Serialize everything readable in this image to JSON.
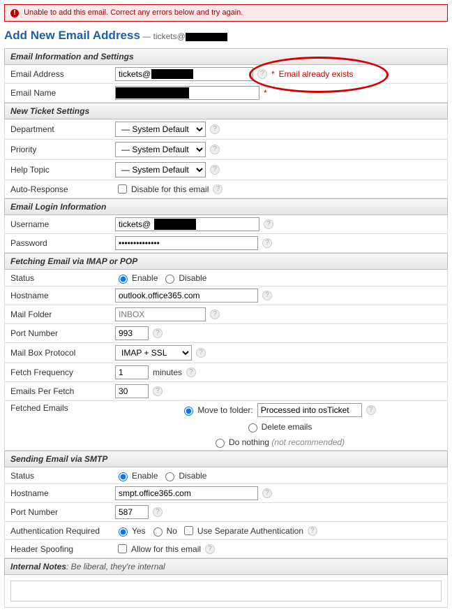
{
  "error_banner": "Unable to add this email. Correct any errors below and try again.",
  "page_title": "Add New Email Address",
  "page_title_sub_prefix": "— tickets@",
  "sections": {
    "info": "Email Information and Settings",
    "ticket": "New Ticket Settings",
    "login": "Email Login Information",
    "fetch": "Fetching Email via IMAP or POP",
    "send": "Sending Email via SMTP",
    "notes": "Internal Notes",
    "notes_hint": ": Be liberal, they're internal"
  },
  "labels": {
    "email_address": "Email Address",
    "email_name": "Email Name",
    "department": "Department",
    "priority": "Priority",
    "help_topic": "Help Topic",
    "auto_response": "Auto-Response",
    "username": "Username",
    "password": "Password",
    "status": "Status",
    "hostname": "Hostname",
    "mail_folder": "Mail Folder",
    "port_number": "Port Number",
    "mailbox_protocol": "Mail Box Protocol",
    "fetch_frequency": "Fetch Frequency",
    "emails_per_fetch": "Emails Per Fetch",
    "fetched_emails": "Fetched Emails",
    "auth_required": "Authentication Required",
    "header_spoofing": "Header Spoofing"
  },
  "values": {
    "email_address_prefix": "tickets@",
    "email_error": "Email already exists",
    "system_default": "— System Default —",
    "disable_for_email": "Disable for this email",
    "username_prefix": "tickets@",
    "password_mask": "••••••••••••••",
    "enable": "Enable",
    "disable": "Disable",
    "fetch_hostname": "outlook.office365.com",
    "mail_folder_ph": "INBOX",
    "fetch_port": "993",
    "protocol": "IMAP + SSL",
    "fetch_freq": "1",
    "minutes": "minutes",
    "per_fetch": "30",
    "move_to_folder": "Move to folder:",
    "processed_into": "Processed into osTicket",
    "delete_emails": "Delete emails",
    "do_nothing": "Do nothing",
    "not_recommended": "(not recommended)",
    "smtp_hostname": "smpt.office365.com",
    "smtp_port": "587",
    "yes": "Yes",
    "no": "No",
    "use_sep_auth": "Use Separate Authentication",
    "allow_for_email": "Allow for this email"
  }
}
